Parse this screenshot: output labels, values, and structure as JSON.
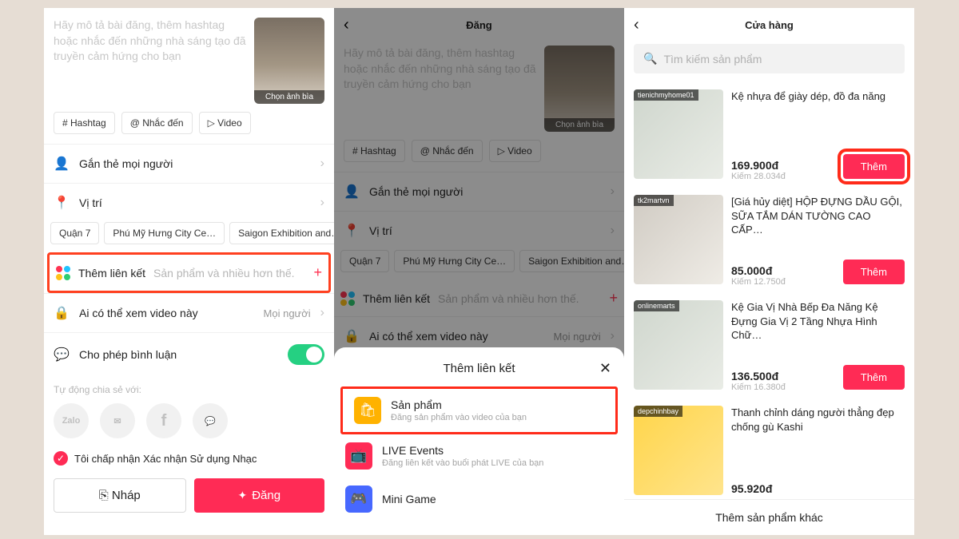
{
  "screen1": {
    "placeholder": "Hãy mô tả bài đăng, thêm hashtag hoặc nhắc đến những nhà sáng tạo đã truyền cảm hứng cho bạn",
    "cover_label": "Chọn ảnh bìa",
    "chips": {
      "hashtag": "# Hashtag",
      "mention": "@ Nhắc đến",
      "video": "▷ Video"
    },
    "rows": {
      "tag": "Gắn thẻ mọi người",
      "location": "Vị trí",
      "who": "Ai có thể xem video này",
      "who_value": "Mọi người",
      "comments": "Cho phép bình luận"
    },
    "loc_chips": [
      "Quận 7",
      "Phú Mỹ Hưng City Ce…",
      "Saigon Exhibition and…"
    ],
    "add_link_title": "Thêm liên kết",
    "add_link_sub": "Sản phẩm và nhiều hơn thế.",
    "share_label": "Tự động chia sẻ với:",
    "share_zalo": "Zalo",
    "accept_text": "Tôi chấp nhận Xác nhận Sử dụng Nhạc",
    "btn_draft": "⎘ Nháp",
    "btn_post": "Đăng"
  },
  "screen2": {
    "header": "Đăng",
    "sheet_title": "Thêm liên kết",
    "items": {
      "product_t": "Sản phẩm",
      "product_s": "Đăng sản phẩm vào video của bạn",
      "live_t": "LIVE Events",
      "live_s": "Đăng liên kết vào buổi phát LIVE của bạn",
      "game_t": "Mini Game"
    }
  },
  "screen3": {
    "header": "Cửa hàng",
    "search_ph": "Tìm kiếm sản phẩm",
    "add": "Thêm",
    "more": "Thêm sản phẩm khác",
    "prods": [
      {
        "tag": "tienichmyhome01",
        "name": "Kệ nhựa để giày dép, đồ đa năng",
        "price": "169.900đ",
        "earn": "Kiếm 28.034đ"
      },
      {
        "tag": "tk2martvn",
        "name": "[Giá hủy diệt] HỘP ĐỰNG DẦU GỘI, SỮA TẮM DÁN TƯỜNG CAO CẤP…",
        "price": "85.000đ",
        "earn": "Kiếm 12.750đ"
      },
      {
        "tag": "onlinemarts",
        "name": "Kệ Gia Vị Nhà Bếp Đa Năng Kệ Đựng Gia Vị 2 Tầng Nhựa Hình Chữ…",
        "price": "136.500đ",
        "earn": "Kiếm 16.380đ"
      },
      {
        "tag": "depchinhbay",
        "name": "Thanh chỉnh dáng người thẳng đẹp chống gù Kashi",
        "price": "95.920đ",
        "earn": ""
      }
    ]
  }
}
